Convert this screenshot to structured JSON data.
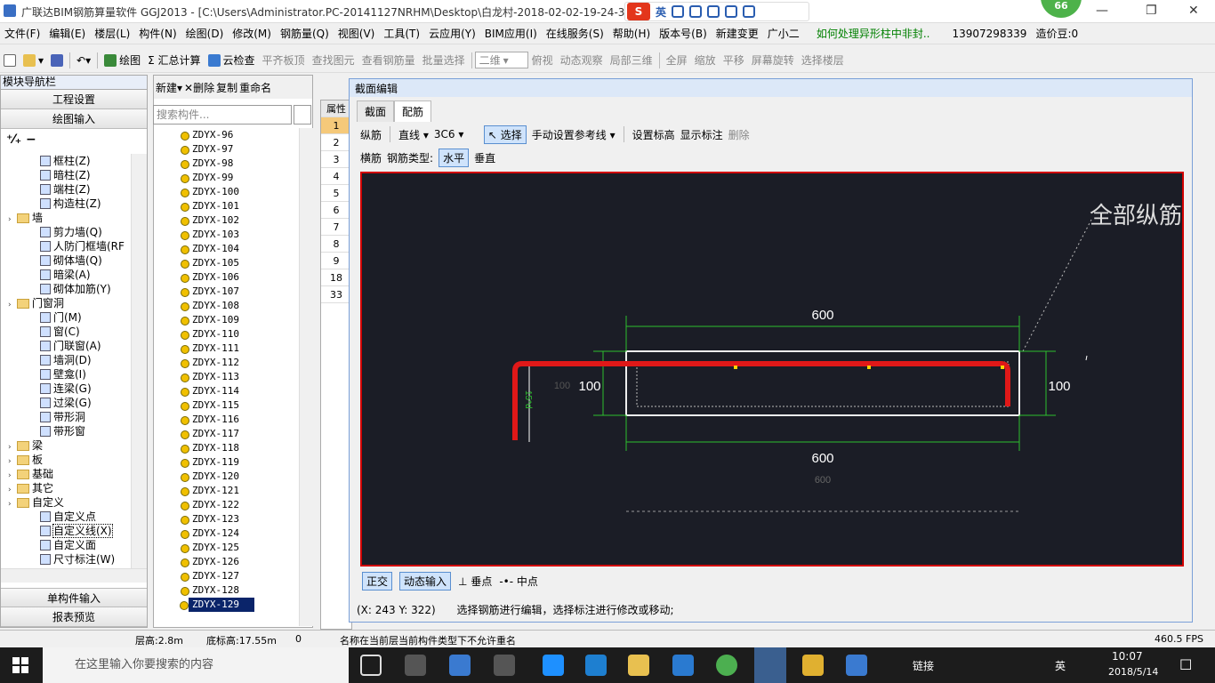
{
  "window": {
    "title": "广联达BIM钢筋算量软件 GGJ2013 - [C:\\Users\\Administrator.PC-20141127NRHM\\Desktop\\白龙村-2018-02-02-19-24-35",
    "ime_label": "S",
    "ime_lang": "英",
    "badge": "66"
  },
  "menu": [
    "文件(F)",
    "编辑(E)",
    "楼层(L)",
    "构件(N)",
    "绘图(D)",
    "修改(M)",
    "钢筋量(Q)",
    "视图(V)",
    "工具(T)",
    "云应用(Y)",
    "BIM应用(I)",
    "在线服务(S)",
    "帮助(H)",
    "版本号(B)",
    "新建变更",
    "广小二",
    "如何处理异形柱中非封..",
    "13907298339",
    "造价豆:0"
  ],
  "toolbar": [
    "绘图",
    "Σ 汇总计算",
    "云检查",
    "平齐板顶",
    "查找图元",
    "查看钢筋量",
    "批量选择",
    "二维",
    "俯视",
    "动态观察",
    "局部三维",
    "全屏",
    "缩放",
    "平移",
    "屏幕旋转",
    "选择楼层"
  ],
  "nav": {
    "header": "模块导航栏",
    "btn1": "工程设置",
    "btn2": "绘图输入",
    "btn3": "单构件输入",
    "btn4": "报表预览",
    "items": [
      {
        "t": "框柱(Z)",
        "lvl": 2
      },
      {
        "t": "暗柱(Z)",
        "lvl": 2
      },
      {
        "t": "端柱(Z)",
        "lvl": 2
      },
      {
        "t": "构造柱(Z)",
        "lvl": 2
      },
      {
        "t": "墙",
        "lvl": 1,
        "f": true
      },
      {
        "t": "剪力墙(Q)",
        "lvl": 2
      },
      {
        "t": "人防门框墙(RF",
        "lvl": 2
      },
      {
        "t": "砌体墙(Q)",
        "lvl": 2
      },
      {
        "t": "暗梁(A)",
        "lvl": 2
      },
      {
        "t": "砌体加筋(Y)",
        "lvl": 2
      },
      {
        "t": "门窗洞",
        "lvl": 1,
        "f": true
      },
      {
        "t": "门(M)",
        "lvl": 2
      },
      {
        "t": "窗(C)",
        "lvl": 2
      },
      {
        "t": "门联窗(A)",
        "lvl": 2
      },
      {
        "t": "墙洞(D)",
        "lvl": 2
      },
      {
        "t": "壁龛(I)",
        "lvl": 2
      },
      {
        "t": "连梁(G)",
        "lvl": 2
      },
      {
        "t": "过梁(G)",
        "lvl": 2
      },
      {
        "t": "带形洞",
        "lvl": 2
      },
      {
        "t": "带形窗",
        "lvl": 2
      },
      {
        "t": "梁",
        "lvl": 1,
        "f": true
      },
      {
        "t": "板",
        "lvl": 1,
        "f": true
      },
      {
        "t": "基础",
        "lvl": 1,
        "f": true
      },
      {
        "t": "其它",
        "lvl": 1,
        "f": true
      },
      {
        "t": "自定义",
        "lvl": 1,
        "f": true
      },
      {
        "t": "自定义点",
        "lvl": 2
      },
      {
        "t": "自定义线(X)",
        "lvl": 2,
        "sel": true
      },
      {
        "t": "自定义面",
        "lvl": 2
      },
      {
        "t": "尺寸标注(W)",
        "lvl": 2
      }
    ]
  },
  "comp": {
    "new": "新建",
    "delete": "删除",
    "copy": "复制",
    "rename": "重命名",
    "search_placeholder": "搜索构件...",
    "items": [
      "ZDYX-96",
      "ZDYX-97",
      "ZDYX-98",
      "ZDYX-99",
      "ZDYX-100",
      "ZDYX-101",
      "ZDYX-102",
      "ZDYX-103",
      "ZDYX-104",
      "ZDYX-105",
      "ZDYX-106",
      "ZDYX-107",
      "ZDYX-108",
      "ZDYX-109",
      "ZDYX-110",
      "ZDYX-111",
      "ZDYX-112",
      "ZDYX-113",
      "ZDYX-114",
      "ZDYX-115",
      "ZDYX-116",
      "ZDYX-117",
      "ZDYX-118",
      "ZDYX-119",
      "ZDYX-120",
      "ZDYX-121",
      "ZDYX-122",
      "ZDYX-123",
      "ZDYX-124",
      "ZDYX-125",
      "ZDYX-126",
      "ZDYX-127",
      "ZDYX-128",
      "ZDYX-129"
    ]
  },
  "props": {
    "header": "属性",
    "rows": [
      "1",
      "2",
      "3",
      "4",
      "5",
      "6",
      "7",
      "8",
      "9",
      "18",
      "33"
    ]
  },
  "dialog": {
    "title": "截面编辑",
    "tab1": "截面",
    "tab2": "配筋",
    "row1": {
      "zj": "纵筋",
      "line": "直线",
      "spec": "3C6",
      "select": "选择",
      "manual": "手动设置参考线",
      "elev": "设置标高",
      "show": "显示标注",
      "del": "删除"
    },
    "row2": {
      "hj": "横筋",
      "type": "钢筋类型:",
      "horiz": "水平",
      "vert": "垂直"
    },
    "canvas": {
      "top_dim": "600",
      "left_dim": "100",
      "left_small": "100",
      "right_dim": "100",
      "bot_dim": "600",
      "bot_small": "600",
      "hook": "15*d",
      "callout": "全部纵筋"
    },
    "bottom": {
      "ortho": "正交",
      "dyn": "动态输入",
      "perp": "垂点",
      "mid": "中点"
    },
    "coords": "(X: 243 Y: 322)",
    "status_msg": "选择钢筋进行编辑，选择标注进行修改或移动;"
  },
  "status": {
    "floor_h": "层高:2.8m",
    "base_h": "底标高:17.55m",
    "zero": "0",
    "msg": "名称在当前层当前构件类型下不允许重名",
    "fps": "460.5 FPS"
  },
  "taskbar": {
    "search": "在这里输入你要搜索的内容",
    "link": "链接",
    "lang": "英",
    "time": "10:07",
    "date": "2018/5/14"
  }
}
